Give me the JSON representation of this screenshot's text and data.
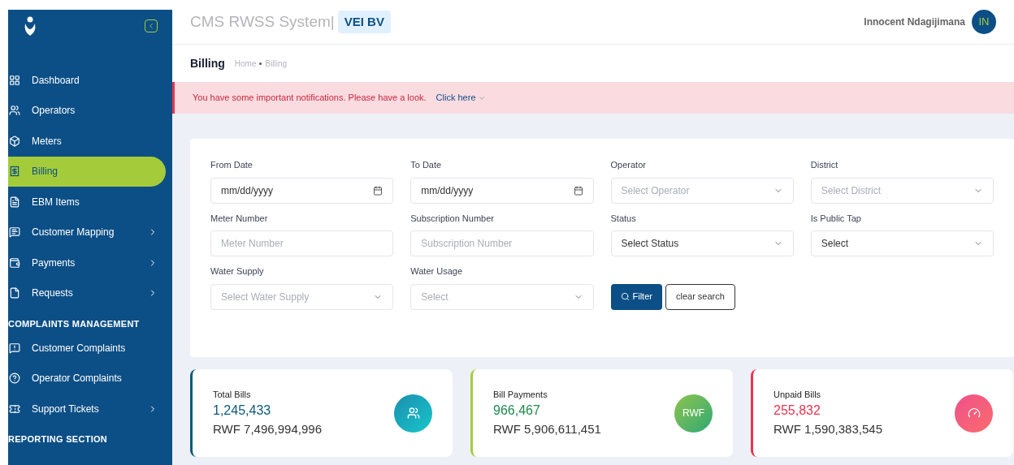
{
  "header": {
    "title": "CMS RWSS System|",
    "org_badge": "VEI BV",
    "user_name": "Innocent Ndagijimana",
    "avatar_initials": "IN"
  },
  "sidebar": {
    "items": [
      {
        "kind": "item",
        "label": "Dashboard",
        "selected": false,
        "has_children": false
      },
      {
        "kind": "item",
        "label": "Operators",
        "selected": false,
        "has_children": false
      },
      {
        "kind": "item",
        "label": "Meters",
        "selected": false,
        "has_children": false
      },
      {
        "kind": "item",
        "label": "Billing",
        "selected": true,
        "has_children": false
      },
      {
        "kind": "item",
        "label": "EBM Items",
        "selected": false,
        "has_children": false
      },
      {
        "kind": "item",
        "label": "Customer Mapping",
        "selected": false,
        "has_children": true
      },
      {
        "kind": "item",
        "label": "Payments",
        "selected": false,
        "has_children": true
      },
      {
        "kind": "item",
        "label": "Requests",
        "selected": false,
        "has_children": true
      },
      {
        "kind": "section",
        "label": "COMPLAINTS MANAGEMENT"
      },
      {
        "kind": "item",
        "label": "Customer Complaints",
        "selected": false,
        "has_children": false
      },
      {
        "kind": "item",
        "label": "Operator Complaints",
        "selected": false,
        "has_children": false
      },
      {
        "kind": "item",
        "label": "Support Tickets",
        "selected": false,
        "has_children": true
      },
      {
        "kind": "section",
        "label": "REPORTING SECTION"
      }
    ]
  },
  "page": {
    "title": "Billing",
    "breadcrumb": [
      "Home",
      "Billing"
    ]
  },
  "alert": {
    "message": "You have some important notifications. Please have a look.",
    "link": "Click here"
  },
  "filters": [
    {
      "label": "From Date",
      "kind": "date",
      "value": "mm/dd/yyyy"
    },
    {
      "label": "To Date",
      "kind": "date",
      "value": "mm/dd/yyyy"
    },
    {
      "label": "Operator",
      "kind": "select",
      "placeholder": "Select Operator"
    },
    {
      "label": "District",
      "kind": "select",
      "placeholder": "Select District"
    },
    {
      "label": "Meter Number",
      "kind": "text",
      "placeholder": "Meter Number"
    },
    {
      "label": "Subscription Number",
      "kind": "text",
      "placeholder": "Subscription Number"
    },
    {
      "label": "Status",
      "kind": "select",
      "value": "Select Status"
    },
    {
      "label": "Is Public Tap",
      "kind": "select",
      "value": "Select"
    },
    {
      "label": "Water Supply",
      "kind": "select",
      "placeholder": "Select Water Supply"
    },
    {
      "label": "Water Usage",
      "kind": "select",
      "placeholder": "Select"
    }
  ],
  "buttons": {
    "filter": "Filter",
    "clear": "clear search"
  },
  "stats": [
    {
      "title": "Total Bills",
      "count": "1,245,433",
      "amount": "RWF 7,496,994,996",
      "color": "#0b5a7a"
    },
    {
      "title": "Bill Payments",
      "count": "966,467",
      "amount": "RWF 5,906,611,451",
      "color": "#a4cc3a",
      "icon_text": "RWF"
    },
    {
      "title": "Unpaid Bills",
      "count": "255,832",
      "amount": "RWF 1,590,383,545",
      "color": "#e8344e"
    }
  ]
}
